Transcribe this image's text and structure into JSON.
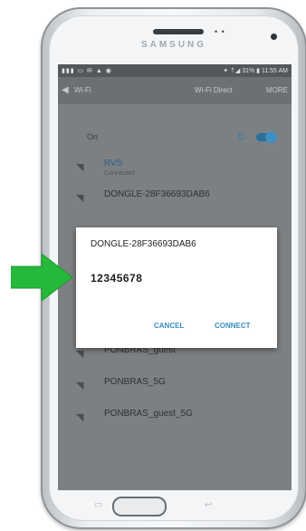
{
  "device": {
    "brand": "SAMSUNG"
  },
  "statusbar": {
    "left_icons": "▮▮▮ ▭ ✉ ▲ ◉",
    "right": "✦ ⇡◢ 31% ▮ 11:55 AM"
  },
  "actionbar": {
    "back_icon": "◀",
    "title": "Wi-Fi",
    "wifi_direct": "Wi-Fi Direct",
    "more": "MORE"
  },
  "wifi_toggle": {
    "label": "On",
    "state": "on"
  },
  "networks": [
    {
      "name": "RVS",
      "status": "Connected"
    },
    {
      "name": "DONGLE-28F36693DAB6",
      "status": ""
    },
    {
      "name": "PONBRAS_guest",
      "status": ""
    },
    {
      "name": "PONBRAS_5G",
      "status": ""
    },
    {
      "name": "PONBRAS_guest_5G",
      "status": ""
    }
  ],
  "dialog": {
    "title": "DONGLE-28F36693DAB6",
    "password": "12345678",
    "cancel": "CANCEL",
    "connect": "CONNECT"
  },
  "colors": {
    "accent": "#3a8fbf",
    "arrow": "#25b83a",
    "screen_dim": "#7d8083"
  },
  "icons": {
    "wifi": "wifi-icon",
    "refresh": "refresh-icon",
    "arrow": "green-arrow-icon"
  }
}
